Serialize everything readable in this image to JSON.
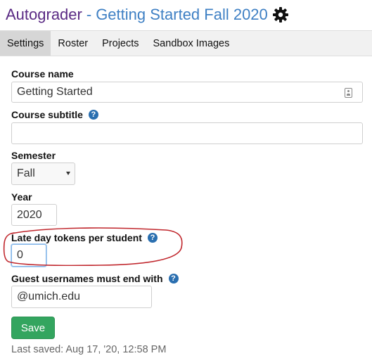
{
  "header": {
    "app_name": "Autograder",
    "separator": "-",
    "course_title": "Getting Started Fall 2020",
    "settings_icon": "gear-icon"
  },
  "tabs": [
    {
      "label": "Settings",
      "active": true
    },
    {
      "label": "Roster",
      "active": false
    },
    {
      "label": "Projects",
      "active": false
    },
    {
      "label": "Sandbox Images",
      "active": false
    }
  ],
  "form": {
    "course_name": {
      "label": "Course name",
      "value": "Getting Started"
    },
    "course_subtitle": {
      "label": "Course subtitle",
      "value": "",
      "help_icon": "question-circle-icon"
    },
    "semester": {
      "label": "Semester",
      "value": "Fall"
    },
    "year": {
      "label": "Year",
      "value": "2020"
    },
    "late_day_tokens": {
      "label": "Late day tokens per student",
      "value": "0",
      "help_icon": "question-circle-icon"
    },
    "guest_usernames": {
      "label": "Guest usernames must end with",
      "value": "@umich.edu",
      "help_icon": "question-circle-icon"
    }
  },
  "save_button": {
    "label": "Save"
  },
  "last_saved": "Last saved: Aug 17, '20, 12:58 PM",
  "colors": {
    "app_name": "#5a2a84",
    "course_title": "#3f80c4",
    "save_button": "#33a55f",
    "help_icon": "#2a6fb0",
    "annotation": "#c0262c"
  }
}
